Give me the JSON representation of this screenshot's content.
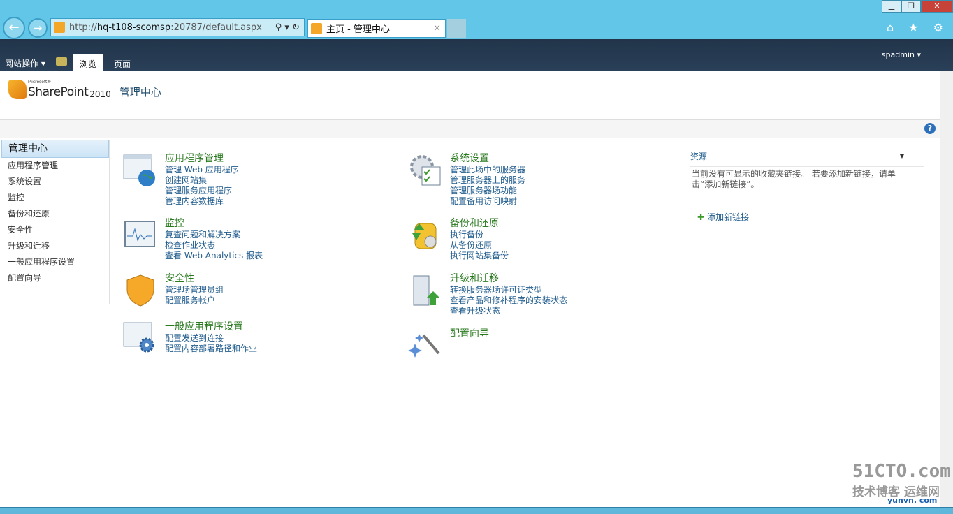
{
  "browser": {
    "url_prefix": "http://",
    "url_domain": "hq-t108-scomsp",
    "url_rest": ":20787/default.aspx",
    "tab_title": "主页 - 管理中心",
    "tools": "⚲ ▾ ↻",
    "tab_close": "×",
    "back": "←",
    "forward": "→",
    "window_min": "▁",
    "window_max": "❐",
    "window_close": "✕",
    "toolbar_icons": "⌂ ★ ⚙"
  },
  "ribbon": {
    "site_actions": "网站操作 ▾",
    "tabs": [
      "浏览",
      "页面"
    ],
    "user": "spadmin ▾"
  },
  "header": {
    "logo_ms": "Microsoft®",
    "logo_sp": "SharePoint",
    "logo_year": "2010",
    "site_title": "管理中心",
    "help": "?"
  },
  "leftnav": [
    "管理中心",
    "应用程序管理",
    "系统设置",
    "监控",
    "备份和还原",
    "安全性",
    "升级和迁移",
    "一般应用程序设置",
    "配置向导"
  ],
  "sections": [
    {
      "title": "应用程序管理",
      "links": [
        "管理 Web 应用程序",
        "创建网站集",
        "管理服务应用程序",
        "管理内容数据库"
      ]
    },
    {
      "title": "监控",
      "links": [
        "复查问题和解决方案",
        "检查作业状态",
        "查看 Web Analytics 报表"
      ]
    },
    {
      "title": "安全性",
      "links": [
        "管理场管理员组",
        "配置服务帐户"
      ]
    },
    {
      "title": "一般应用程序设置",
      "links": [
        "配置发送到连接",
        "配置内容部署路径和作业"
      ]
    },
    {
      "title": "系统设置",
      "links": [
        "管理此场中的服务器",
        "管理服务器上的服务",
        "管理服务器场功能",
        "配置备用访问映射"
      ]
    },
    {
      "title": "备份和还原",
      "links": [
        "执行备份",
        "从备份还原",
        "执行网站集备份"
      ]
    },
    {
      "title": "升级和迁移",
      "links": [
        "转换服务器场许可证类型",
        "查看产品和修补程序的安装状态",
        "查看升级状态"
      ]
    },
    {
      "title": "配置向导",
      "links": []
    }
  ],
  "resources": {
    "title": "资源",
    "dropdown": "▼",
    "empty": "当前没有可显示的收藏夹链接。 若要添加新链接，请单击“添加新链接”。",
    "plus": "✚",
    "add": "添加新链接"
  },
  "watermark": {
    "a": "51CTO.com",
    "b": "技术博客 运维网",
    "c": "yunvn. com"
  }
}
